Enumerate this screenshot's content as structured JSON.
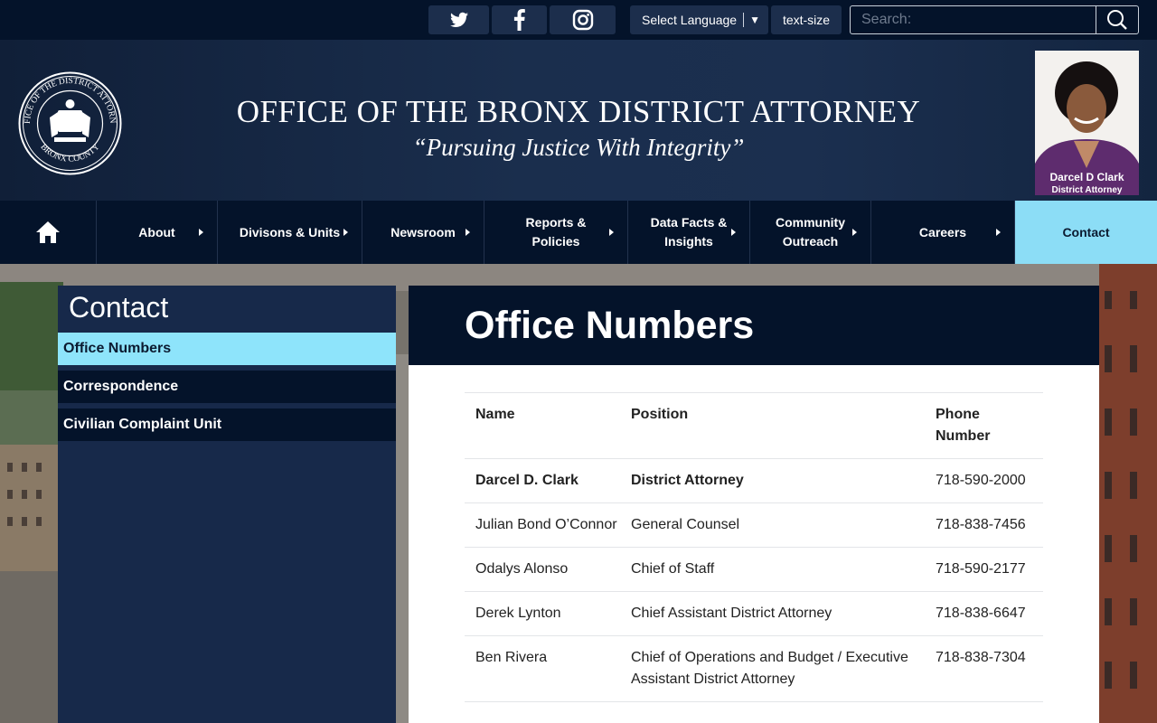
{
  "topbar": {
    "social": [
      "twitter-icon",
      "facebook-icon",
      "instagram-icon"
    ],
    "language_label": "Select Language",
    "language_arrow": "▼",
    "text_size_label": "text-size",
    "search_placeholder": "Search:"
  },
  "header": {
    "title": "OFFICE OF THE BRONX DISTRICT ATTORNEY",
    "tagline": "“Pursuing Justice With Integrity”",
    "seal_text_top": "OFFICE OF THE DISTRICT ATTORNEY",
    "seal_text_bottom": "BRONX COUNTY",
    "portrait_name": "Darcel D Clark",
    "portrait_title": "District Attorney"
  },
  "nav": {
    "items": [
      {
        "label": "About"
      },
      {
        "label": "Divisons & Units"
      },
      {
        "label": "Newsroom"
      },
      {
        "label": "Reports & Policies",
        "line1": "Reports &",
        "line2": "Policies"
      },
      {
        "label": "Data Facts & Insights",
        "line1": "Data Facts &",
        "line2": "Insights"
      },
      {
        "label": "Community Outreach",
        "line1": "Community",
        "line2": "Outreach"
      },
      {
        "label": "Careers"
      },
      {
        "label": "Contact"
      }
    ]
  },
  "side": {
    "title": "Contact",
    "items": [
      {
        "label": "Office Numbers"
      },
      {
        "label": "Correspondence"
      },
      {
        "label": "Civilian Complaint Unit"
      }
    ]
  },
  "main": {
    "title": "Office Numbers",
    "headers": {
      "name": "Name",
      "position": "Position",
      "phone_line1": "Phone",
      "phone_line2": "Number"
    },
    "rows": [
      {
        "name": "Darcel D. Clark",
        "position": "District Attorney",
        "phone": "718-590-2000"
      },
      {
        "name": "Julian Bond O’Connor",
        "position": "General Counsel",
        "phone": "718-838-7456"
      },
      {
        "name": "Odalys Alonso",
        "position": "Chief of Staff",
        "phone": "718-590-2177"
      },
      {
        "name": "Derek Lynton",
        "position": "Chief Assistant District Attorney",
        "phone": "718-838-6647"
      },
      {
        "name": "Ben Rivera",
        "position": "Chief of Operations and Budget / Executive Assistant District Attorney",
        "phone": "718-838-7304"
      }
    ]
  },
  "colors": {
    "navy": "#04132a",
    "header_blue": "#1a2e4d",
    "accent_cyan": "#8ee4fb"
  }
}
